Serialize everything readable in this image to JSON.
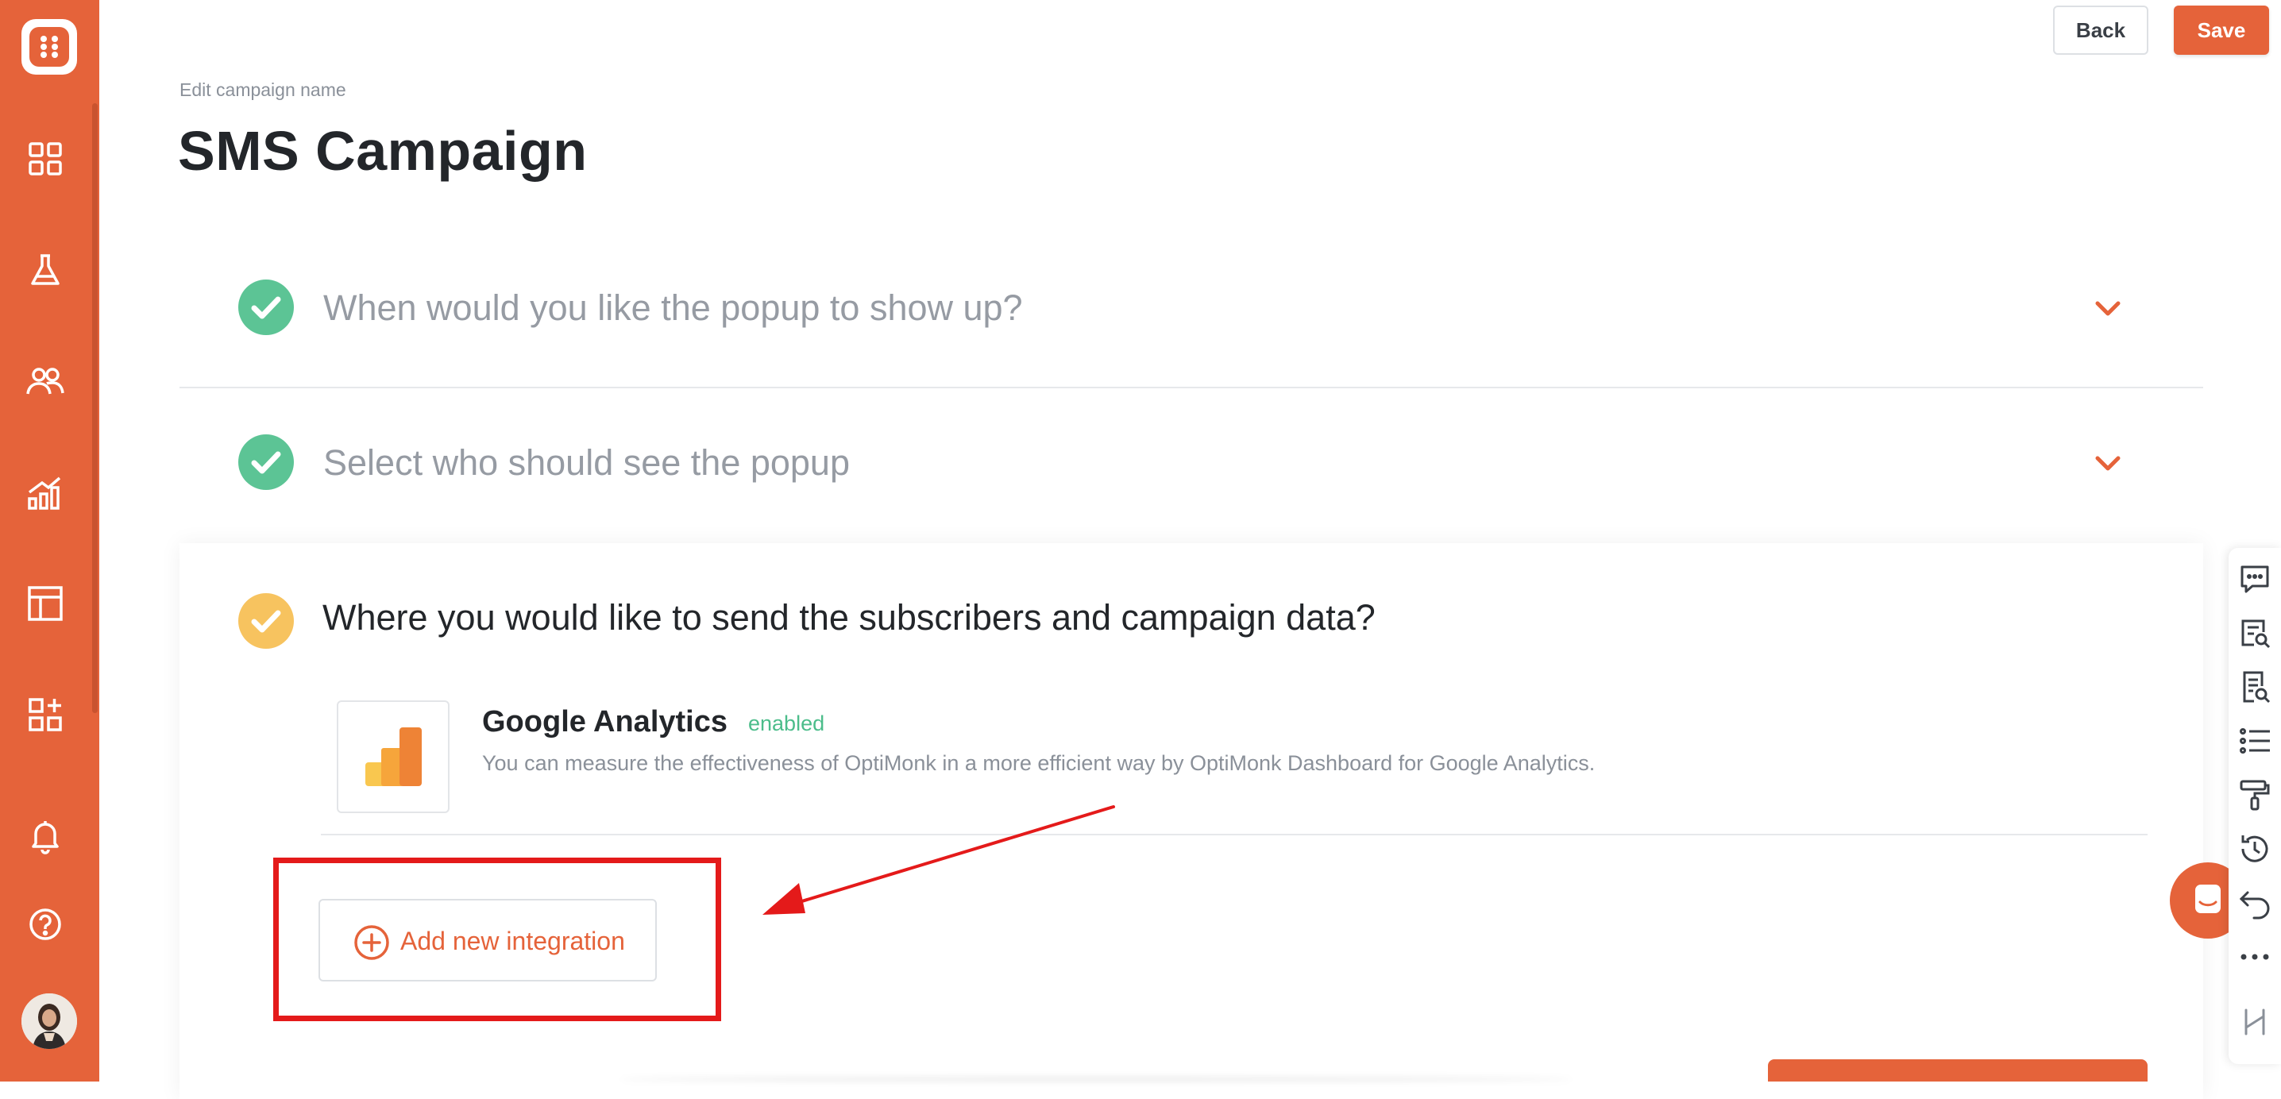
{
  "header": {
    "back_label": "Back",
    "save_label": "Save",
    "edit_label": "Edit campaign name",
    "title": "SMS Campaign"
  },
  "sidebar": {
    "items": [
      {
        "icon": "dashboard-icon"
      },
      {
        "icon": "flask-icon"
      },
      {
        "icon": "users-icon"
      },
      {
        "icon": "analytics-icon"
      },
      {
        "icon": "templates-icon"
      },
      {
        "icon": "integrations-icon"
      },
      {
        "icon": "bell-icon"
      },
      {
        "icon": "help-icon"
      }
    ]
  },
  "steps": [
    {
      "title": "When would you like the popup to show up?",
      "status": "complete"
    },
    {
      "title": "Select who should see the popup",
      "status": "complete"
    },
    {
      "title": "Where you would like to send the subscribers and campaign data?",
      "status": "in-progress"
    }
  ],
  "integration": {
    "name": "Google Analytics",
    "status": "enabled",
    "description": "You can measure the effectiveness of OptiMonk in a more efficient way by OptiMonk Dashboard for Google Analytics."
  },
  "add_integration_label": "Add new integration",
  "right_toolbar": [
    "comments-icon",
    "search-doc-icon",
    "review-icon",
    "list-icon",
    "paint-roller-icon",
    "history-icon",
    "undo-icon",
    "more-icon",
    "collapse-icon"
  ],
  "colors": {
    "brand": "#e5633a",
    "success": "#5cc495",
    "warning": "#f7c35f",
    "annotation": "#e41a1a"
  }
}
